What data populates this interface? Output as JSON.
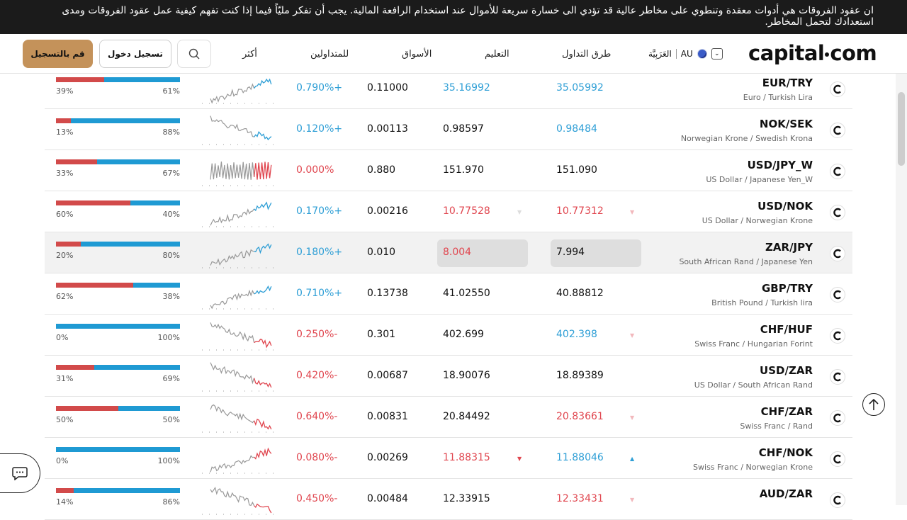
{
  "banner": {
    "text": "ان عقود الفروقات هي أدوات معقدة وتنطوي على مخاطر عالية قد تؤدي الى خسارة سريعة للأموال عند استخدام الرافعة المالية. يجب أن تفكر مليّاً فيما إذا كنت تفهم كيفية عمل عقود الفروقات ومدى استعدادك لتحمل المخاطر."
  },
  "header": {
    "logo": [
      "capital",
      "com"
    ],
    "region": "AU",
    "language": "العَرَبِيَّة",
    "nav": [
      "طرق التداول",
      "التعليم",
      "الأسواق",
      "للمتداولين",
      "أكثر"
    ],
    "login_label": "تسجيل دخول",
    "signup_label": "قم بالتسجيل"
  },
  "colors": {
    "up": "#2f9fd6",
    "down": "#e0464f",
    "sell_bar": "#d24a4a",
    "buy_bar": "#1f9ad3",
    "signup": "#c4925a"
  },
  "rows": [
    {
      "symbol": "EUR/TRY",
      "name": "Euro / Turkish Lira",
      "buy": "35.05992",
      "buy_color": "up",
      "sell": "35.16992",
      "sell_color": "up",
      "spread": "0.11000",
      "change": "0.790%+",
      "change_dir": "up",
      "sell_pct": 39,
      "buy_pct": 61,
      "pct_left": "39%",
      "pct_right": "61%",
      "spark_dir": "up",
      "highlight": false
    },
    {
      "symbol": "NOK/SEK",
      "name": "Norwegian Krone / Swedish Krona",
      "buy": "0.98484",
      "buy_color": "up",
      "sell": "0.98597",
      "sell_color": "neutral",
      "spread": "0.00113",
      "change": "0.120%+",
      "change_dir": "up",
      "sell_pct": 12,
      "buy_pct": 88,
      "pct_left": "13%",
      "pct_right": "88%",
      "spark_dir": "down",
      "highlight": false
    },
    {
      "symbol": "USD/JPY_W",
      "name": "US Dollar / Japanese Yen_W",
      "buy": "151.090",
      "buy_color": "neutral",
      "sell": "151.970",
      "sell_color": "neutral",
      "spread": "0.880",
      "change": "0.000%",
      "change_dir": "down",
      "sell_pct": 33,
      "buy_pct": 67,
      "pct_left": "33%",
      "pct_right": "67%",
      "spark_dir": "flat",
      "highlight": false
    },
    {
      "symbol": "USD/NOK",
      "name": "US Dollar / Norwegian Krone",
      "buy": "10.77312",
      "buy_color": "down",
      "sell": "10.77528",
      "sell_color": "down",
      "spread": "0.00216",
      "change": "0.170%+",
      "change_dir": "up",
      "sell_pct": 60,
      "buy_pct": 40,
      "pct_left": "60%",
      "pct_right": "40%",
      "spark_dir": "up",
      "highlight": false,
      "arrows": "faint"
    },
    {
      "symbol": "ZAR/JPY",
      "name": "South African Rand / Japanese Yen",
      "buy": "7.994",
      "buy_color": "neutral",
      "sell": "8.004",
      "sell_color": "down",
      "spread": "0.010",
      "change": "0.180%+",
      "change_dir": "up",
      "sell_pct": 20,
      "buy_pct": 80,
      "pct_left": "20%",
      "pct_right": "80%",
      "spark_dir": "up",
      "highlight": true,
      "boxed": true
    },
    {
      "symbol": "GBP/TRY",
      "name": "British Pound / Turkish lira",
      "buy": "40.88812",
      "buy_color": "neutral",
      "sell": "41.02550",
      "sell_color": "neutral",
      "spread": "0.13738",
      "change": "0.710%+",
      "change_dir": "up",
      "sell_pct": 62,
      "buy_pct": 38,
      "pct_left": "62%",
      "pct_right": "38%",
      "spark_dir": "up",
      "highlight": false
    },
    {
      "symbol": "CHF/HUF",
      "name": "Swiss Franc / Hungarian Forint",
      "buy": "402.398",
      "buy_color": "up",
      "sell": "402.699",
      "sell_color": "neutral",
      "spread": "0.301",
      "change": "0.250%-",
      "change_dir": "down",
      "sell_pct": 0,
      "buy_pct": 100,
      "pct_left": "0%",
      "pct_right": "100%",
      "spark_dir": "down",
      "highlight": false,
      "arrows": "faint-buy"
    },
    {
      "symbol": "USD/ZAR",
      "name": "US Dollar / South African Rand",
      "buy": "18.89389",
      "buy_color": "neutral",
      "sell": "18.90076",
      "sell_color": "neutral",
      "spread": "0.00687",
      "change": "0.420%-",
      "change_dir": "down",
      "sell_pct": 31,
      "buy_pct": 69,
      "pct_left": "31%",
      "pct_right": "69%",
      "spark_dir": "down",
      "highlight": false
    },
    {
      "symbol": "CHF/ZAR",
      "name": "Swiss Franc / Rand",
      "buy": "20.83661",
      "buy_color": "down",
      "sell": "20.84492",
      "sell_color": "neutral",
      "spread": "0.00831",
      "change": "0.640%-",
      "change_dir": "down",
      "sell_pct": 50,
      "buy_pct": 50,
      "pct_left": "50%",
      "pct_right": "50%",
      "spark_dir": "down",
      "highlight": false,
      "arrows": "faint-buy"
    },
    {
      "symbol": "CHF/NOK",
      "name": "Swiss Franc / Norwegian Krone",
      "buy": "11.88046",
      "buy_color": "up",
      "sell": "11.88315",
      "sell_color": "down",
      "spread": "0.00269",
      "change": "0.080%-",
      "change_dir": "down",
      "sell_pct": 0,
      "buy_pct": 100,
      "pct_left": "0%",
      "pct_right": "100%",
      "spark_dir": "up",
      "highlight": false,
      "arrows": "strong"
    },
    {
      "symbol": "AUD/ZAR",
      "name": "",
      "buy": "12.33431",
      "buy_color": "down",
      "sell": "12.33915",
      "sell_color": "neutral",
      "spread": "0.00484",
      "change": "0.450%-",
      "change_dir": "down",
      "sell_pct": 14,
      "buy_pct": 86,
      "pct_left": "14%",
      "pct_right": "86%",
      "spark_dir": "down",
      "highlight": false,
      "arrows": "faint-buy"
    }
  ]
}
